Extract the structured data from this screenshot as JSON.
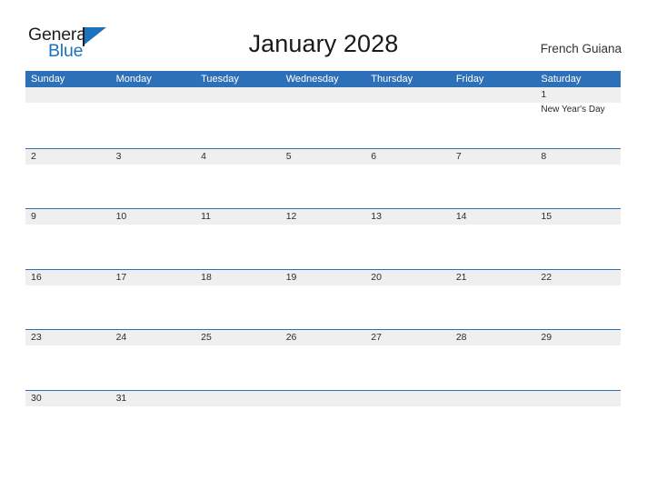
{
  "brand": {
    "word_one": "General",
    "word_two": "Blue",
    "flag_icon": "triangle-flag-icon",
    "color_dark": "#231f20",
    "color_blue": "#1b74bb"
  },
  "header": {
    "title": "January 2028",
    "region": "French Guiana"
  },
  "theme": {
    "header_blue": "#2e70b8",
    "band_gray": "#efefef",
    "rule_blue": "#2e70b8",
    "text_dark": "#2b2b2b"
  },
  "calendar": {
    "weekdays": [
      "Sunday",
      "Monday",
      "Tuesday",
      "Wednesday",
      "Thursday",
      "Friday",
      "Saturday"
    ],
    "weeks": [
      {
        "days": [
          {
            "number": "",
            "events": []
          },
          {
            "number": "",
            "events": []
          },
          {
            "number": "",
            "events": []
          },
          {
            "number": "",
            "events": []
          },
          {
            "number": "",
            "events": []
          },
          {
            "number": "",
            "events": []
          },
          {
            "number": "1",
            "events": [
              "New Year's Day"
            ]
          }
        ]
      },
      {
        "days": [
          {
            "number": "2",
            "events": []
          },
          {
            "number": "3",
            "events": []
          },
          {
            "number": "4",
            "events": []
          },
          {
            "number": "5",
            "events": []
          },
          {
            "number": "6",
            "events": []
          },
          {
            "number": "7",
            "events": []
          },
          {
            "number": "8",
            "events": []
          }
        ]
      },
      {
        "days": [
          {
            "number": "9",
            "events": []
          },
          {
            "number": "10",
            "events": []
          },
          {
            "number": "11",
            "events": []
          },
          {
            "number": "12",
            "events": []
          },
          {
            "number": "13",
            "events": []
          },
          {
            "number": "14",
            "events": []
          },
          {
            "number": "15",
            "events": []
          }
        ]
      },
      {
        "days": [
          {
            "number": "16",
            "events": []
          },
          {
            "number": "17",
            "events": []
          },
          {
            "number": "18",
            "events": []
          },
          {
            "number": "19",
            "events": []
          },
          {
            "number": "20",
            "events": []
          },
          {
            "number": "21",
            "events": []
          },
          {
            "number": "22",
            "events": []
          }
        ]
      },
      {
        "days": [
          {
            "number": "23",
            "events": []
          },
          {
            "number": "24",
            "events": []
          },
          {
            "number": "25",
            "events": []
          },
          {
            "number": "26",
            "events": []
          },
          {
            "number": "27",
            "events": []
          },
          {
            "number": "28",
            "events": []
          },
          {
            "number": "29",
            "events": []
          }
        ]
      },
      {
        "days": [
          {
            "number": "30",
            "events": []
          },
          {
            "number": "31",
            "events": []
          },
          {
            "number": "",
            "events": []
          },
          {
            "number": "",
            "events": []
          },
          {
            "number": "",
            "events": []
          },
          {
            "number": "",
            "events": []
          },
          {
            "number": "",
            "events": []
          }
        ]
      }
    ]
  }
}
